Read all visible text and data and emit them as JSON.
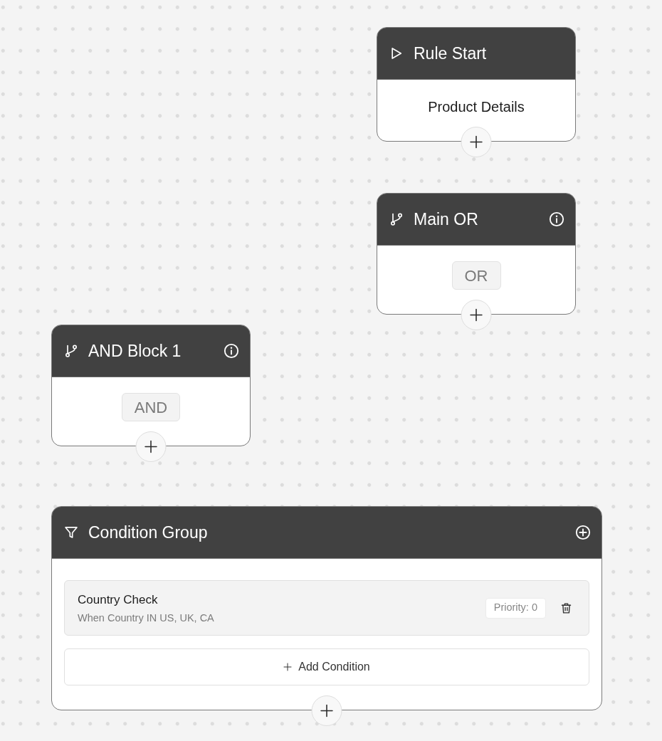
{
  "canvas": {
    "nodes": [
      {
        "kind": "start",
        "title": "Rule Start",
        "subtitle": "Product Details"
      },
      {
        "kind": "logic",
        "title": "Main OR",
        "badge": "OR"
      },
      {
        "kind": "logic",
        "title": "AND Block 1",
        "badge": "AND"
      },
      {
        "kind": "group",
        "title": "Condition Group",
        "conditions": [
          {
            "name": "Country Check",
            "description": "When Country IN US, UK, CA",
            "priority": "Priority: 0"
          }
        ],
        "add_button": "Add Condition"
      }
    ]
  }
}
